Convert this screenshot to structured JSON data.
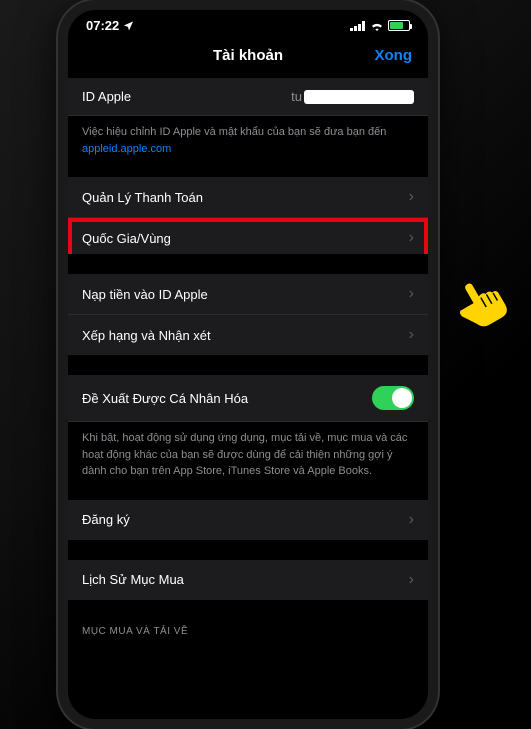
{
  "status": {
    "time": "07:22",
    "location_icon": "▸"
  },
  "nav": {
    "title": "Tài khoản",
    "done": "Xong"
  },
  "apple_id": {
    "label": "ID Apple",
    "value_prefix": "tu",
    "footer_pre": "Việc hiệu chỉnh ID Apple và mật khẩu của bạn sẽ đưa bạn đến ",
    "footer_link": "appleid.apple.com"
  },
  "rows": {
    "payment": "Quản Lý Thanh Toán",
    "country": "Quốc Gia/Vùng",
    "addfunds": "Nạp tiền vào ID Apple",
    "ratings": "Xếp hạng và Nhận xét",
    "personalized": "Đề Xuất Được Cá Nhân Hóa",
    "subscribe": "Đăng ký",
    "purchasehistory": "Lịch Sử Mục Mua"
  },
  "personalized_footer": "Khi bật, hoạt động sử dụng ứng dụng, mục tải về, mục mua và các hoạt động khác của bạn sẽ được dùng để cải thiện những gợi ý dành cho bạn trên App Store, iTunes Store và Apple Books.",
  "section_header": "MỤC MUA VÀ TẢI VỀ"
}
